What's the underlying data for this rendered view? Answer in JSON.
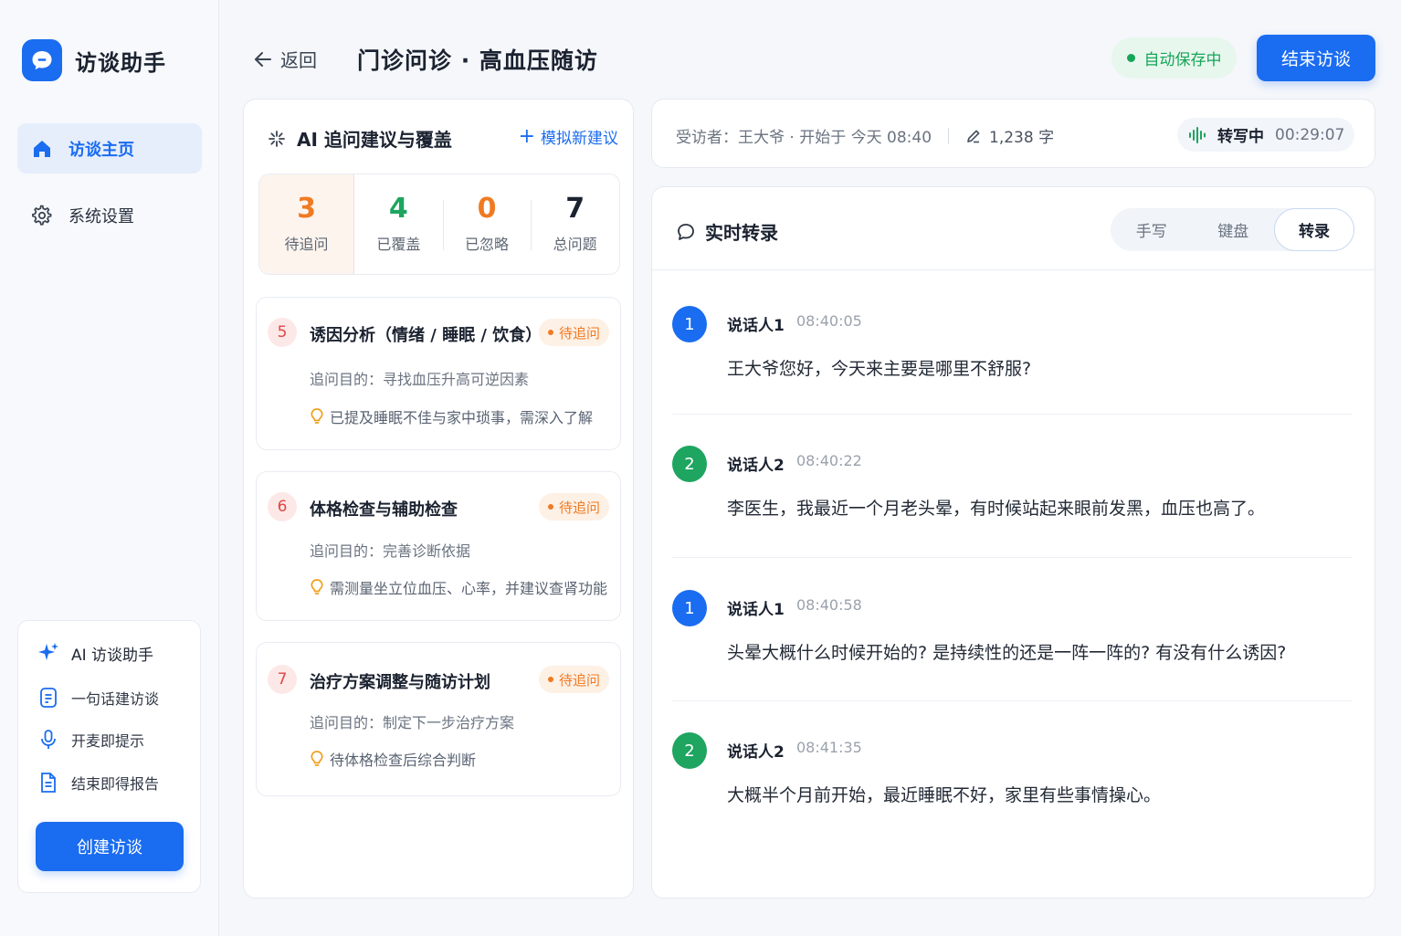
{
  "app": {
    "name": "访谈助手"
  },
  "sidebar": {
    "items": [
      {
        "label": "访谈主页"
      },
      {
        "label": "系统设置"
      }
    ],
    "promo": {
      "title": "AI 访谈助手",
      "features": [
        "一句话建访谈",
        "开麦即提示",
        "结束即得报告"
      ],
      "create_label": "创建访谈"
    }
  },
  "header": {
    "back_label": "返回",
    "title": "门诊问诊 · 高血压随访",
    "autosave": "自动保存中",
    "end_label": "结束访谈"
  },
  "suggestions": {
    "title": "AI 追问建议与覆盖",
    "simulate_label": "模拟新建议",
    "stats": [
      {
        "value": "3",
        "label": "待追问",
        "color": "#f07a22"
      },
      {
        "value": "4",
        "label": "已覆盖",
        "color": "#1ea560"
      },
      {
        "value": "0",
        "label": "已忽略",
        "color": "#f07a22"
      },
      {
        "value": "7",
        "label": "总问题",
        "color": "#1b2230"
      }
    ],
    "items": [
      {
        "no": "5",
        "title": "诱因分析（情绪 / 睡眠 / 饮食）",
        "status": "待追问",
        "purpose": "追问目的：寻找血压升高可逆因素",
        "tip": "已提及睡眠不佳与家中琐事，需深入了解"
      },
      {
        "no": "6",
        "title": "体格检查与辅助检查",
        "status": "待追问",
        "purpose": "追问目的：完善诊断依据",
        "tip": "需测量坐立位血压、心率，并建议查肾功能"
      },
      {
        "no": "7",
        "title": "治疗方案调整与随访计划",
        "status": "待追问",
        "purpose": "追问目的：制定下一步治疗方案",
        "tip": "待体格检查后综合判断"
      }
    ]
  },
  "info": {
    "interviewee": "受访者：王大爷 · 开始于 今天 08:40",
    "word_count": "1,238 字",
    "status_label": "转写中",
    "elapsed": "00:29:07"
  },
  "transcript": {
    "title": "实时转录",
    "modes": [
      "手写",
      "键盘",
      "转录"
    ],
    "active_mode": "转录",
    "messages": [
      {
        "avatar": "1",
        "speaker": "说话人1",
        "time": "08:40:05",
        "text": "王大爷您好，今天来主要是哪里不舒服?"
      },
      {
        "avatar": "2",
        "speaker": "说话人2",
        "time": "08:40:22",
        "text": "李医生，我最近一个月老头晕，有时候站起来眼前发黑，血压也高了。"
      },
      {
        "avatar": "1",
        "speaker": "说话人1",
        "time": "08:40:58",
        "text": "头晕大概什么时候开始的? 是持续性的还是一阵一阵的? 有没有什么诱因?"
      },
      {
        "avatar": "2",
        "speaker": "说话人2",
        "time": "08:41:35",
        "text": "大概半个月前开始，最近睡眠不好，家里有些事情操心。"
      }
    ]
  },
  "colors": {
    "accent": "#1a6cf0",
    "success": "#1ea560",
    "warning": "#f07a22",
    "danger": "#e04646"
  }
}
